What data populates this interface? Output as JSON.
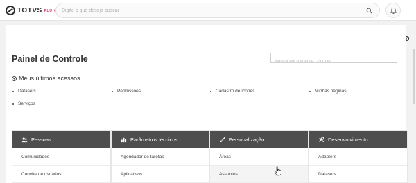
{
  "header": {
    "logo_text": "TOTVS",
    "logo_sub": "FLUIG",
    "search_placeholder": "Digite o que deseja buscar"
  },
  "panel": {
    "title": "Painel de Controle",
    "search_placeholder": "Buscar em Painel de Controle",
    "recent": {
      "label": "Meus últimos acessos",
      "items": [
        "Datasets",
        "Permissões",
        "Cadastro de ícones",
        "Minhas páginas",
        "Serviços"
      ]
    },
    "cards": [
      {
        "title": "Pessoas",
        "icon": "people-icon",
        "items": [
          "Comunidades",
          "Convite de usuários"
        ]
      },
      {
        "title": "Parâmetros técnicos",
        "icon": "bar-chart-icon",
        "items": [
          "Agendador de tarefas",
          "Aplicativos"
        ]
      },
      {
        "title": "Personalização",
        "icon": "brush-icon",
        "items": [
          "Áreas",
          "Assuntos"
        ]
      },
      {
        "title": "Desenvolvimento",
        "icon": "tools-icon",
        "items": [
          "Adapters",
          "Datasets"
        ]
      }
    ]
  },
  "colors": {
    "card_header": "#4e4e4e",
    "background": "#f2f2f2",
    "logo_accent": "#d23b6b"
  }
}
